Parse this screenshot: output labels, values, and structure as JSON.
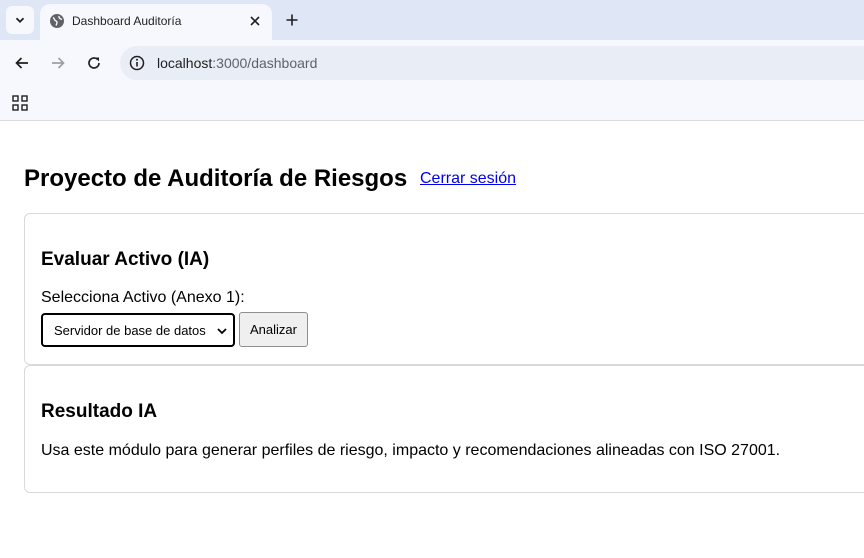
{
  "browser": {
    "tab_title": "Dashboard Auditoría",
    "url_host": "localhost",
    "url_path": ":3000/dashboard",
    "icons": {
      "tab_search": "chevron-down-icon",
      "favicon": "globe-icon",
      "tab_close": "close-icon",
      "new_tab": "plus-icon",
      "back": "arrow-left-icon",
      "forward": "arrow-right-icon",
      "reload": "reload-icon",
      "site_info": "info-icon",
      "apps": "grid-icon"
    }
  },
  "page": {
    "title": "Proyecto de Auditoría de Riesgos",
    "logout_label": "Cerrar sesión"
  },
  "evaluate_card": {
    "heading": "Evaluar Activo (IA)",
    "select_label": "Selecciona Activo (Anexo 1):",
    "selected_asset": "Servidor de base de datos",
    "analyze_label": "Analizar"
  },
  "result_card": {
    "heading": "Resultado IA",
    "message": "Usa este módulo para generar perfiles de riesgo, impacto y recomendaciones alineadas con ISO 27001."
  },
  "colors": {
    "link": "#0000ee",
    "tabstrip": "#dfe6f5",
    "toolbar": "#f7f8fd",
    "card_border": "#d9d9d9"
  }
}
